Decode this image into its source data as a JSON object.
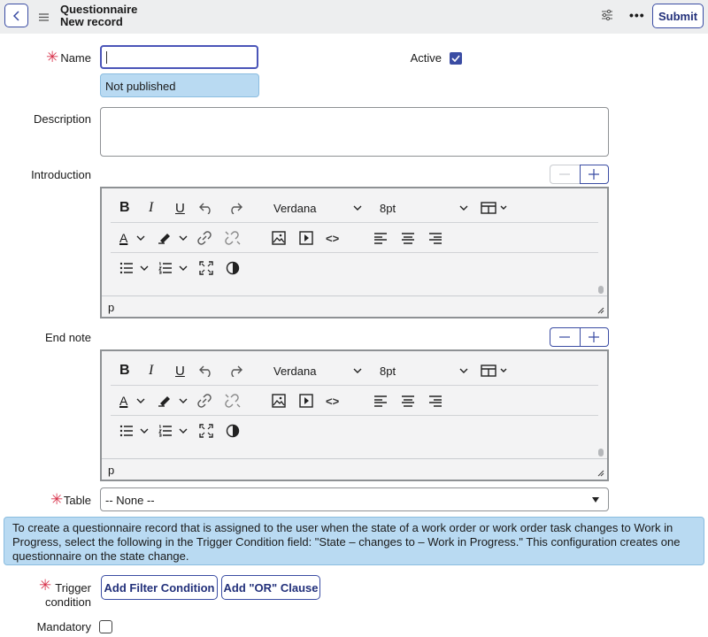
{
  "header": {
    "title": "Questionnaire",
    "subtitle": "New record",
    "submit_label": "Submit",
    "more_label": "•••"
  },
  "form": {
    "name_label": "Name",
    "name_value": "",
    "publish_status": "Not published",
    "active_label": "Active",
    "active_checked": true,
    "description_label": "Description",
    "introduction_label": "Introduction",
    "end_note_label": "End note",
    "table_label": "Table",
    "table_value": "-- None --",
    "info_text": "To create a questionnaire record that is assigned to the user when the state of a work order or work order task changes to Work in Progress, select the following in the Trigger Condition field: \"State – changes to – Work in Progress.\" This configuration creates one questionnaire on the state change.",
    "trigger_label_line1": "Trigger",
    "trigger_label_line2": "condition",
    "add_filter_label": "Add Filter Condition",
    "add_or_label": "Add \"OR\" Clause",
    "mandatory_label": "Mandatory",
    "mandatory_checked": false,
    "required_mark": "✳"
  },
  "editor": {
    "font_family": "Verdana",
    "font_size": "8pt",
    "element_path": "p",
    "bold_glyph": "B",
    "italic_glyph": "I",
    "underline_glyph": "U",
    "textcolor_glyph": "A",
    "code_glyph": "<>"
  },
  "colors": {
    "accent": "#3a4ca3",
    "required": "#d8344d",
    "info_bg": "#b9daf2",
    "header_bg": "#edeeef"
  }
}
